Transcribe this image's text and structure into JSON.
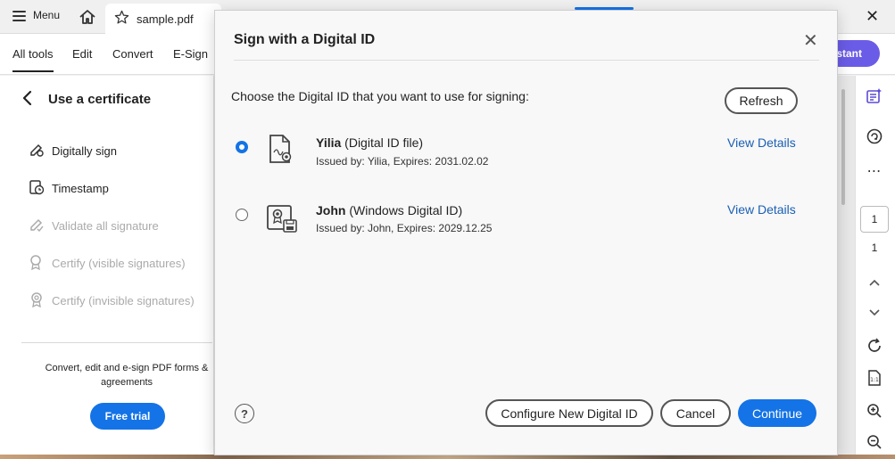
{
  "topbar": {
    "menu_label": "Menu",
    "doc_tab": "sample.pdf",
    "icons": [
      "hamburger-icon",
      "home-icon",
      "star-icon",
      "close-icon"
    ]
  },
  "toolbar": {
    "tabs": [
      "All tools",
      "Edit",
      "Convert",
      "E-Sign"
    ],
    "assistant_label": "istant"
  },
  "leftpanel": {
    "title": "Use a certificate",
    "items": [
      {
        "label": "Digitally sign",
        "icon": "digital-sign-icon",
        "enabled": true
      },
      {
        "label": "Timestamp",
        "icon": "timestamp-icon",
        "enabled": true
      },
      {
        "label": "Validate all signature",
        "icon": "validate-icon",
        "enabled": false
      },
      {
        "label": "Certify (visible signatures)",
        "icon": "certify-visible-icon",
        "enabled": false
      },
      {
        "label": "Certify (invisible signatures)",
        "icon": "certify-invisible-icon",
        "enabled": false
      }
    ],
    "promo": "Convert, edit and e-sign PDF forms & agreements",
    "trial_label": "Free trial"
  },
  "rightrail": {
    "page_current": "1",
    "page_total": "1"
  },
  "modal": {
    "title": "Sign with a Digital ID",
    "prompt": "Choose the Digital ID that you want to use for signing:",
    "refresh_label": "Refresh",
    "ids": [
      {
        "name": "Yilia",
        "type": "(Digital ID file)",
        "issued": "Issued by: Yilia, Expires: 2031.02.02",
        "selected": true,
        "icon": "digital-id-file-icon",
        "view": "View Details"
      },
      {
        "name": "John",
        "type": "(Windows Digital ID)",
        "issued": "Issued by: John, Expires: 2029.12.25",
        "selected": false,
        "icon": "windows-digital-id-icon",
        "view": "View Details"
      }
    ],
    "configure_label": "Configure New Digital ID",
    "cancel_label": "Cancel",
    "continue_label": "Continue",
    "help_glyph": "?"
  },
  "colors": {
    "accent": "#1473e6",
    "assistant": "#6b5ce7",
    "link": "#1a5fb4"
  }
}
